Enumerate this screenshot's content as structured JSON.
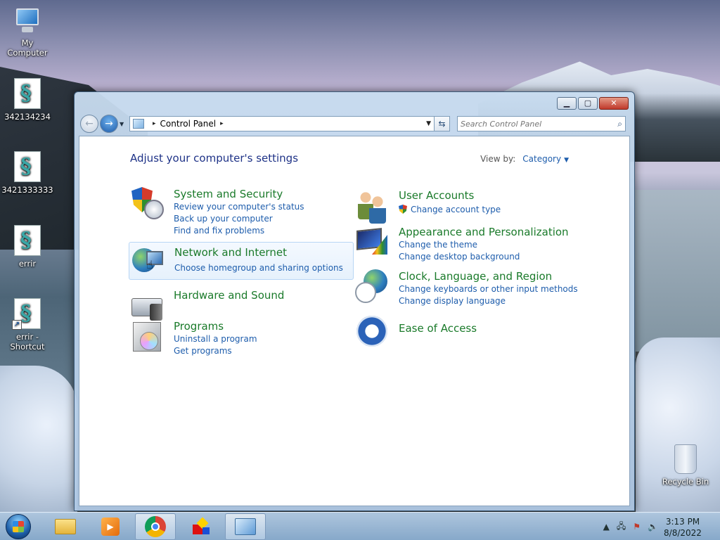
{
  "desktop": {
    "icons": [
      {
        "label": "My Computer"
      },
      {
        "label": "342134234"
      },
      {
        "label": "3421333333"
      },
      {
        "label": "errir"
      },
      {
        "label": "errir - Shortcut"
      },
      {
        "label": "Recycle Bin"
      }
    ]
  },
  "window": {
    "controls": {
      "minimize": "▁",
      "maximize": "▢",
      "close": "✕"
    },
    "address": {
      "segment": "Control Panel",
      "separator": "▸"
    },
    "search": {
      "placeholder": "Search Control Panel"
    },
    "content": {
      "title": "Adjust your computer's settings",
      "view_by_label": "View by:",
      "view_by_value": "Category"
    },
    "categories_left": [
      {
        "heading": "System and Security",
        "links": [
          "Review your computer's status",
          "Back up your computer",
          "Find and fix problems"
        ],
        "icon": "shield-icon"
      },
      {
        "heading": "Network and Internet",
        "links": [
          "Choose homegroup and sharing options"
        ],
        "icon": "network-globe-icon"
      },
      {
        "heading": "Hardware and Sound",
        "links": [],
        "icon": "printer-speaker-icon"
      },
      {
        "heading": "Programs",
        "links": [
          "Uninstall a program",
          "Get programs"
        ],
        "icon": "programs-box-icon"
      }
    ],
    "categories_right": [
      {
        "heading": "User Accounts",
        "links": [
          "Change account type"
        ],
        "icon": "users-icon"
      },
      {
        "heading": "Appearance and Personalization",
        "links": [
          "Change the theme",
          "Change desktop background"
        ],
        "icon": "appearance-icon"
      },
      {
        "heading": "Clock, Language, and Region",
        "links": [
          "Change keyboards or other input methods",
          "Change display language"
        ],
        "icon": "clock-globe-icon"
      },
      {
        "heading": "Ease of Access",
        "links": [],
        "icon": "ease-of-access-icon"
      }
    ]
  },
  "taskbar": {
    "items": [
      "start-button",
      "explorer",
      "media-player",
      "chrome",
      "app-tool",
      "control-panel"
    ],
    "clock": {
      "time": "3:13 PM",
      "date": "8/8/2022"
    }
  }
}
